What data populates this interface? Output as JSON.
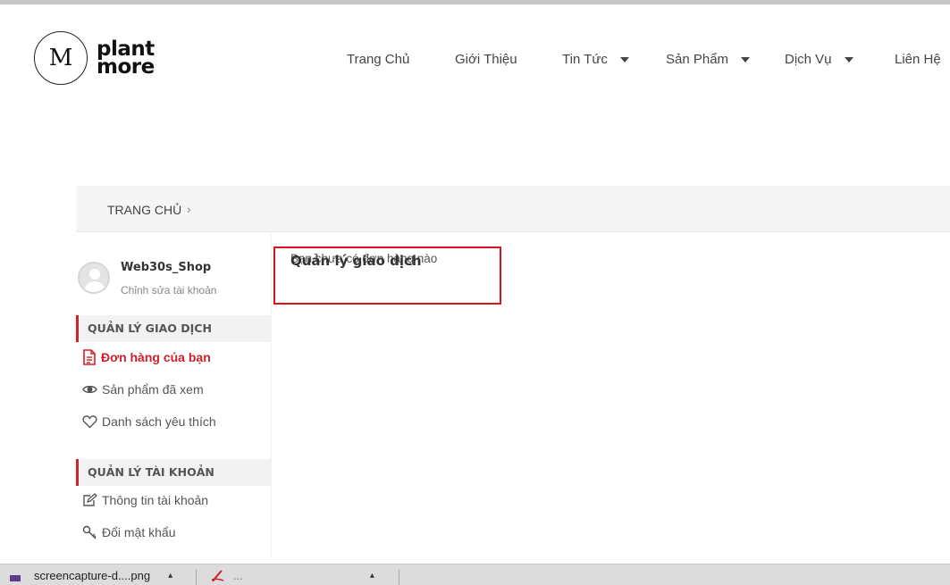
{
  "brand": {
    "logo_glyph": "M",
    "line1": "plant",
    "line2": "more"
  },
  "nav": [
    {
      "label": "Trang Chủ",
      "dropdown": false
    },
    {
      "label": "Giới Thiệu",
      "dropdown": false
    },
    {
      "label": "Tin Tức",
      "dropdown": true
    },
    {
      "label": "Sản Phẩm",
      "dropdown": true
    },
    {
      "label": "Dịch Vụ",
      "dropdown": true
    },
    {
      "label": "Liên Hệ",
      "dropdown": false
    }
  ],
  "breadcrumb": {
    "home": "Trang chủ",
    "separator": "›"
  },
  "account": {
    "username": "Web30s_Shop",
    "edit_label": "Chỉnh sửa tài khoản"
  },
  "sidebar": {
    "transactions_heading": "Quản lý giao dịch",
    "transactions": [
      {
        "label": "Đơn hàng của bạn",
        "icon": "document-icon",
        "active": true
      },
      {
        "label": "Sản phẩm đã xem",
        "icon": "eye-icon",
        "active": false
      },
      {
        "label": "Danh sách yêu thích",
        "icon": "heart-icon",
        "active": false
      }
    ],
    "account_heading": "Quản lý tài khoản",
    "account": [
      {
        "label": "Thông tin tài khoản",
        "icon": "edit-icon"
      },
      {
        "label": "Đổi mật khẩu",
        "icon": "key-icon"
      }
    ]
  },
  "content": {
    "title": "Quản lý giao dịch",
    "empty_message": "Bạn chưa có đơn hàng nào"
  },
  "downloads": [
    {
      "name": "screencapture-d....png",
      "icon": "image-file-icon"
    },
    {
      "name": "...",
      "icon": "pdf-file-icon"
    }
  ],
  "colors": {
    "accent": "#d0202a",
    "highlight_border": "#d9141e"
  }
}
